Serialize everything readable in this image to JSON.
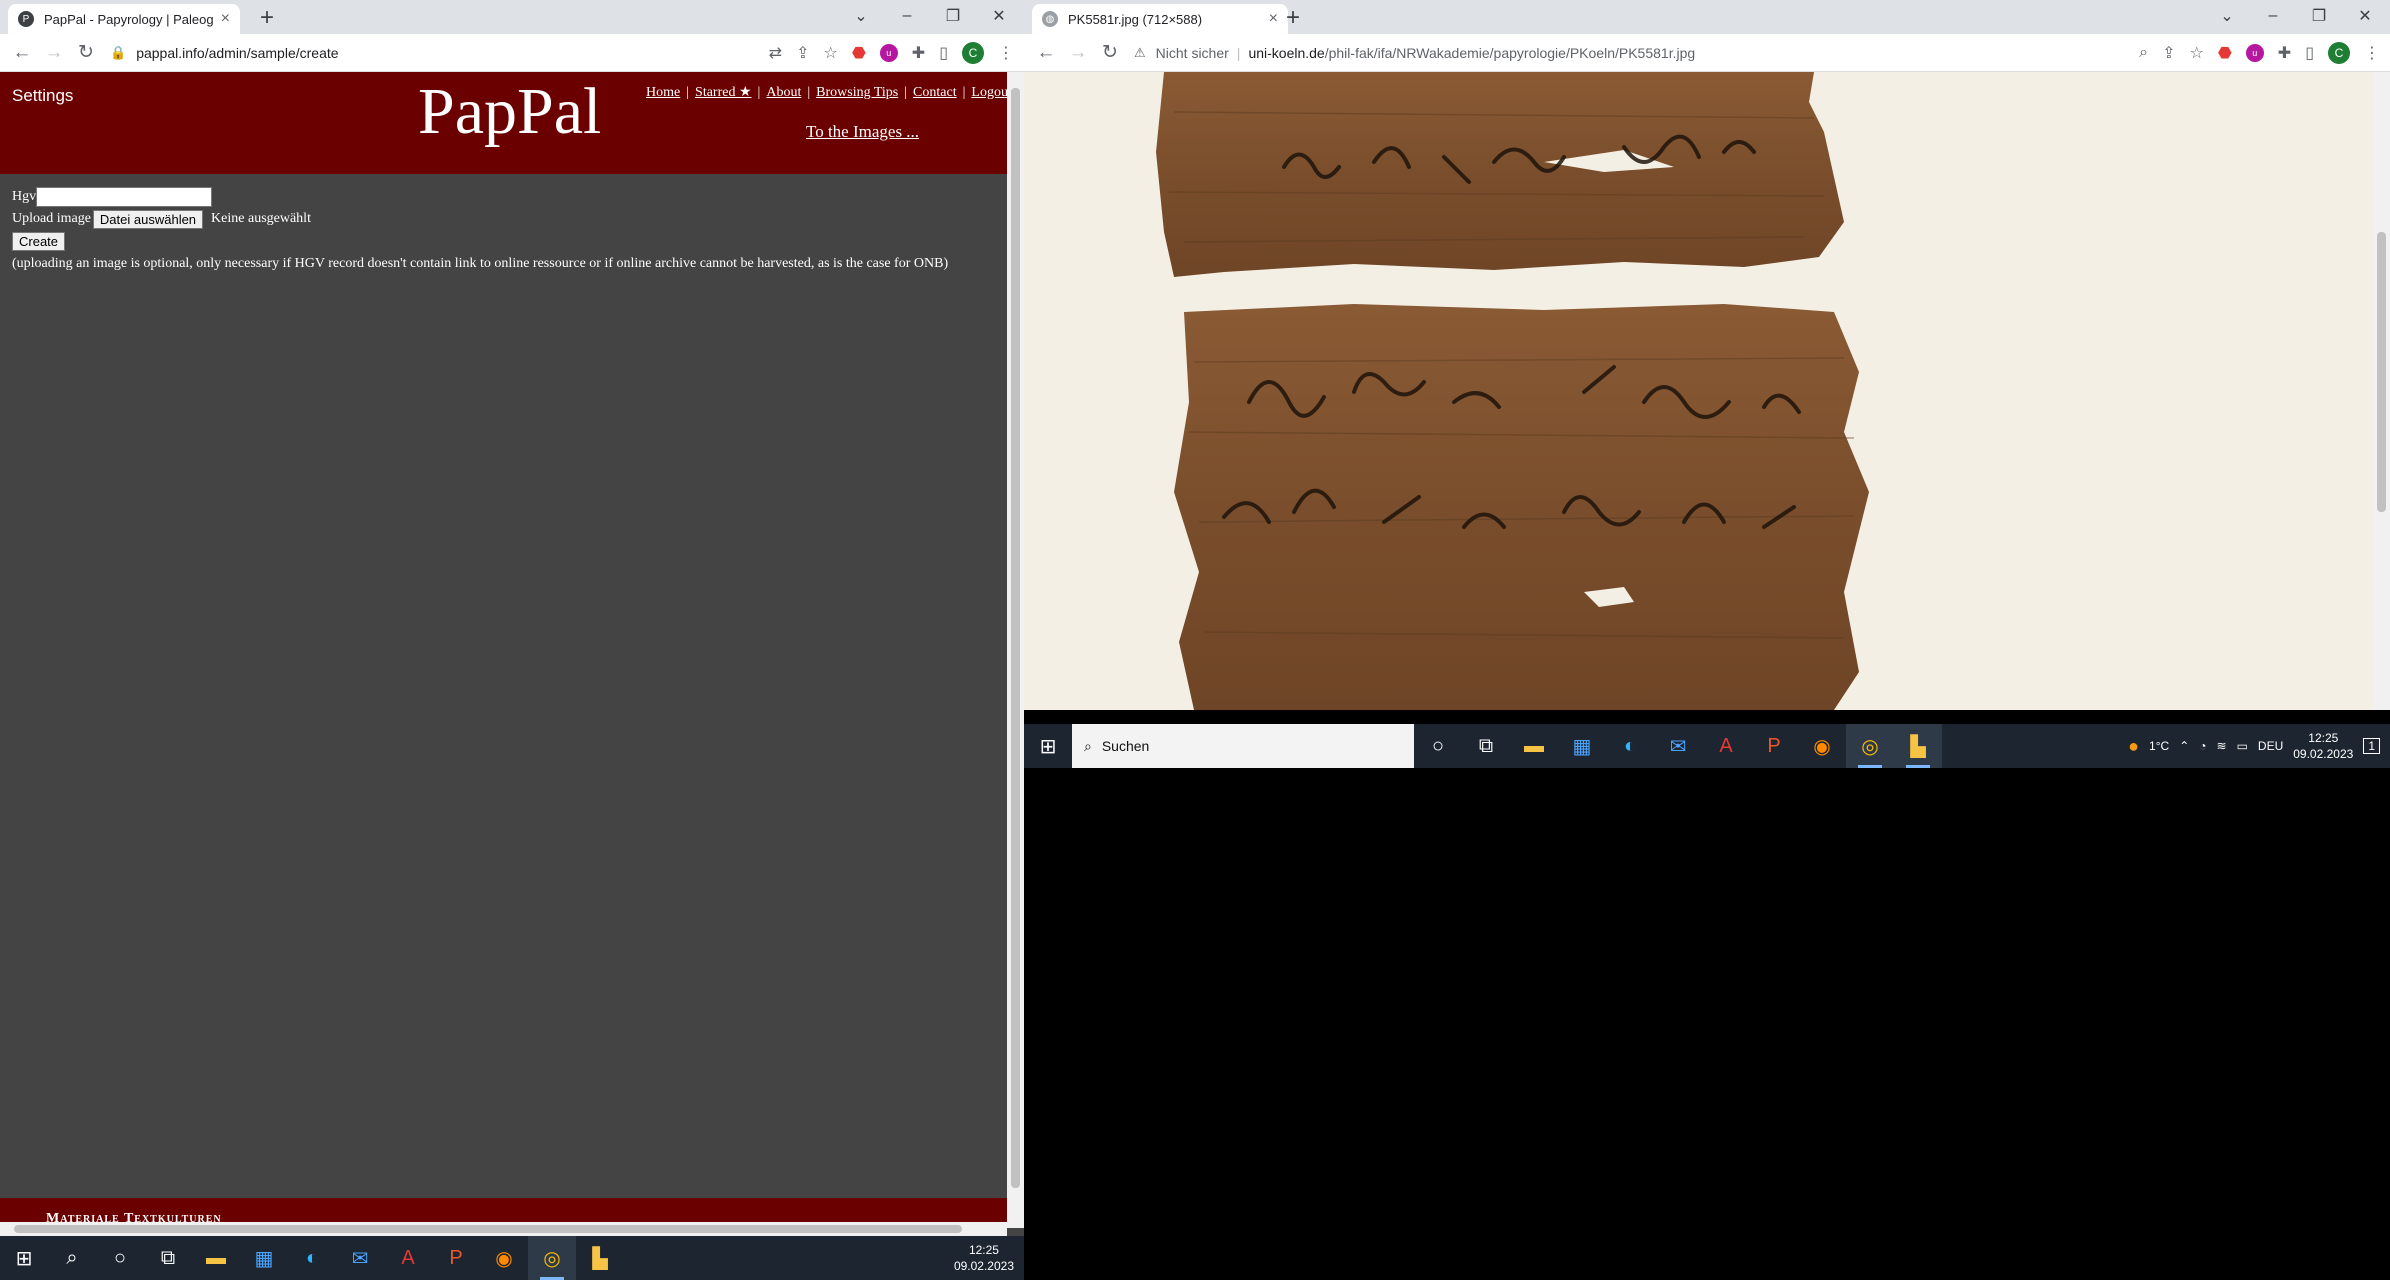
{
  "left_browser": {
    "tab_title": "PapPal - Papyrology | Paleograph",
    "tab_favicon": "pappal-favicon",
    "url": "pappal.info/admin/sample/create"
  },
  "right_browser": {
    "tab_title": "PK5581r.jpg (712×588)",
    "security_label": "Nicht sicher",
    "url_domain": "uni-koeln.de",
    "url_path": "/phil-fak/ifa/NRWakademie/papyrologie/PKoeln/PK5581r.jpg"
  },
  "pappal": {
    "settings": "Settings",
    "logo": "PapPal",
    "nav": [
      "Home",
      "Starred ★",
      "About",
      "Browsing Tips",
      "Contact",
      "Logout"
    ],
    "to_images": "To the Images ...",
    "hgv_label": "Hgv",
    "upload_label": "Upload image",
    "file_button": "Datei auswählen",
    "file_status": "Keine ausgewählt",
    "create_button": "Create",
    "note": "(uploading an image is optional, only necessary if HGV record doesn't contain link to online ressource or if online archive cannot be harvested, as is the case for ONB)",
    "footer": "Materiale Textkulturen"
  },
  "taskbar_left": {
    "time": "12:25",
    "date": "09.02.2023"
  },
  "taskbar_right": {
    "search_placeholder": "Suchen",
    "temperature": "1°C",
    "language": "DEU",
    "time": "12:25",
    "date": "09.02.2023",
    "notification_count": "1"
  },
  "colors": {
    "pappal_red": "#6b0000",
    "page_bg": "#444444",
    "papyrus": "#7a4e2c"
  }
}
